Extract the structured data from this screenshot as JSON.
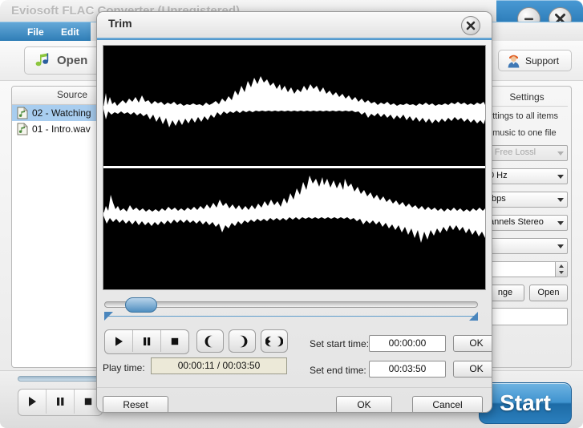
{
  "main_window": {
    "title": "Eviosoft FLAC Converter (Unregistered)",
    "minimize_icon": "minimize-icon",
    "close_icon": "close-icon",
    "menu": [
      {
        "label": "File"
      },
      {
        "label": "Edit"
      }
    ],
    "toolbar": {
      "open_label": "Open",
      "open_icon": "music-note-icon",
      "support_label": "Support",
      "support_icon": "person-icon"
    },
    "file_list": {
      "columns": [
        "Source"
      ],
      "rows": [
        {
          "name": "02 - Watching",
          "selected": true,
          "icon": "audio-file-icon"
        },
        {
          "name": "01 - Intro.wav",
          "selected": false,
          "icon": "audio-file-icon"
        }
      ]
    },
    "settings_panel": {
      "title": "Settings",
      "apply_all_label": "ettings to all  items",
      "merge_label": "t music to one file",
      "format_value": "- Free Lossl",
      "samplerate_value": "0 Hz",
      "bitrate_value": ":bps",
      "channels_value": "annels Stereo",
      "quality_value": "",
      "volume_value": "",
      "change_label": "nge",
      "open_label": "Open"
    },
    "bottom_bar": {
      "play_icon": "play-icon",
      "pause_icon": "pause-icon",
      "stop_icon": "stop-icon",
      "start_label": "Start"
    }
  },
  "trim_dialog": {
    "title": "Trim",
    "close_icon": "close-icon",
    "waveform": {
      "channels": 2,
      "background_color": "#000000",
      "wave_color": "#ffffff"
    },
    "transport": {
      "play_icon": "play-icon",
      "pause_icon": "pause-icon",
      "stop_icon": "stop-icon",
      "set_start_icon": "mark-start-icon",
      "set_end_icon": "mark-end-icon",
      "play_selection_icon": "play-selection-icon"
    },
    "play_time_label": "Play time:",
    "play_time_value": "00:00:11 / 00:03:50",
    "set_start_label": "Set start time:",
    "start_time_value": "00:00:00",
    "start_time_ok": "OK",
    "set_end_label": "Set end time:",
    "end_time_value": "00:03:50",
    "end_time_ok": "OK",
    "reset_label": "Reset",
    "ok_label": "OK",
    "cancel_label": "Cancel"
  },
  "colors": {
    "accent_blue": "#2d7cb5",
    "selection_blue": "#a8cdef",
    "marker_blue": "#4a86bd",
    "playtime_bg": "#ece9d8"
  }
}
